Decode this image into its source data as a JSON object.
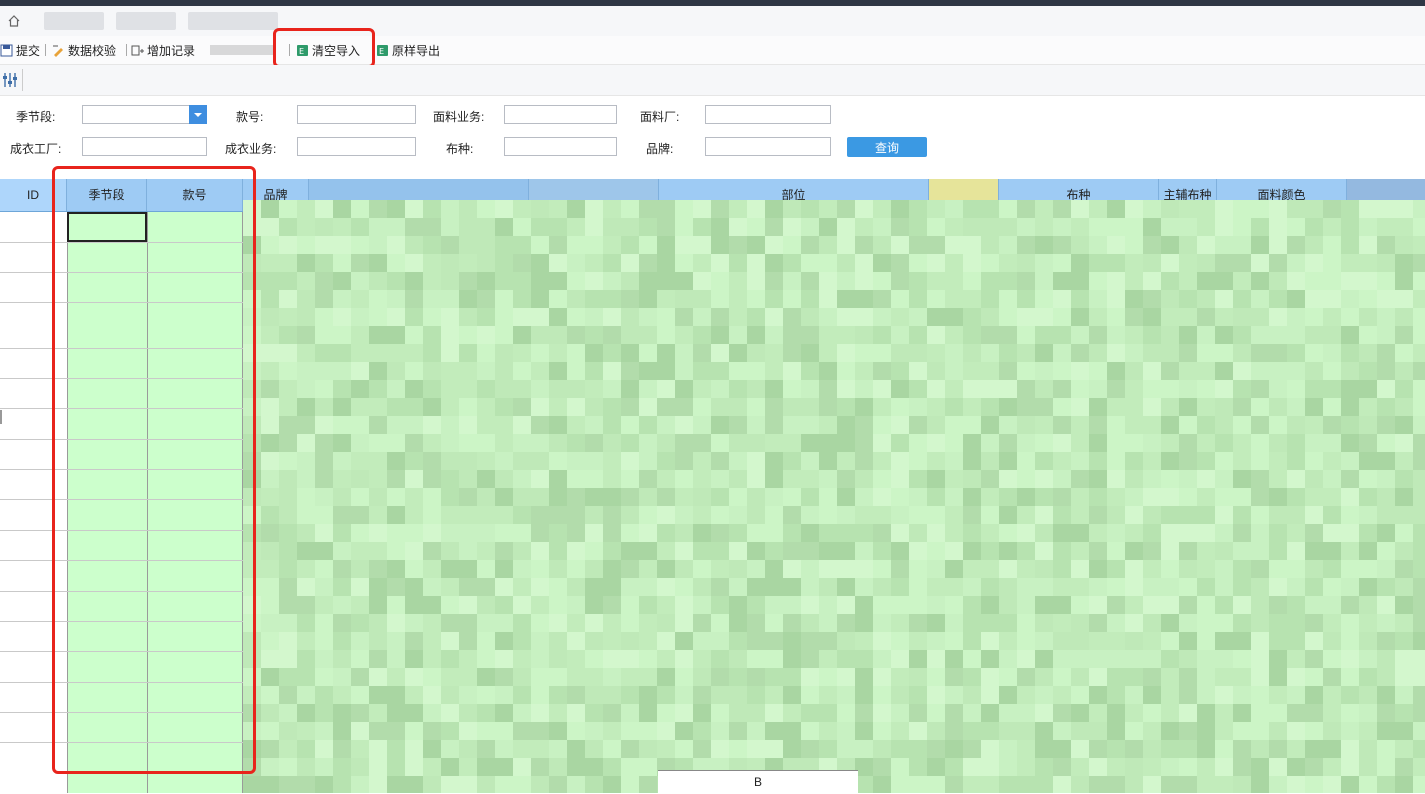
{
  "toolbar": {
    "submit": "提交",
    "validate": "数据校验",
    "add_record": "增加记录",
    "clear_import": "清空导入",
    "export_original": "原样导出"
  },
  "form": {
    "season_label": "季节段:",
    "style_label": "款号:",
    "fabric_sales_label": "面料业务:",
    "fabric_factory_label": "面料厂:",
    "garment_factory_label": "成衣工厂:",
    "garment_sales_label": "成衣业务:",
    "fabric_type_label": "布种:",
    "brand_label": "品牌:",
    "query_button": "查询"
  },
  "table": {
    "headers": {
      "id": "ID",
      "season": "季节段",
      "style": "款号",
      "brand": "品牌",
      "part": "部位",
      "fabric_type": "布种",
      "main_fabric": "主辅布种",
      "fabric_color": "面料颜色"
    },
    "footer_cell": "B"
  },
  "colors": {
    "header_bg": "#9ecbf4",
    "cell_green": "#ccffcc",
    "highlight_red": "#e8241c",
    "query_button": "#3b99e3"
  }
}
